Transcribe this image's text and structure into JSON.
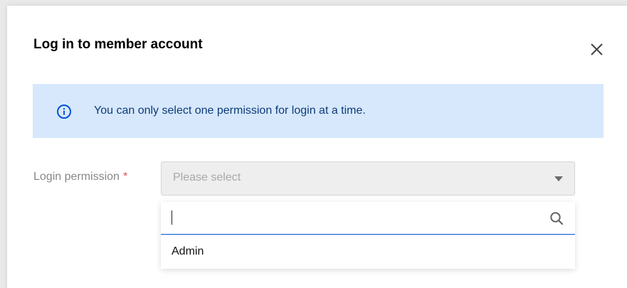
{
  "dialog": {
    "title": "Log in to member account",
    "close_icon": "close-icon"
  },
  "alert": {
    "icon": "info-icon",
    "message": "You can only select one permission for login at a time.",
    "color": "#0052d9",
    "background": "#d7e8fc"
  },
  "form": {
    "label": "Login permission",
    "required_mark": "*",
    "select": {
      "placeholder": "Please select",
      "caret_icon": "caret-down-icon"
    }
  },
  "dropdown": {
    "search": {
      "value": "",
      "icon": "search-icon"
    },
    "options": [
      {
        "label": "Admin"
      }
    ]
  }
}
